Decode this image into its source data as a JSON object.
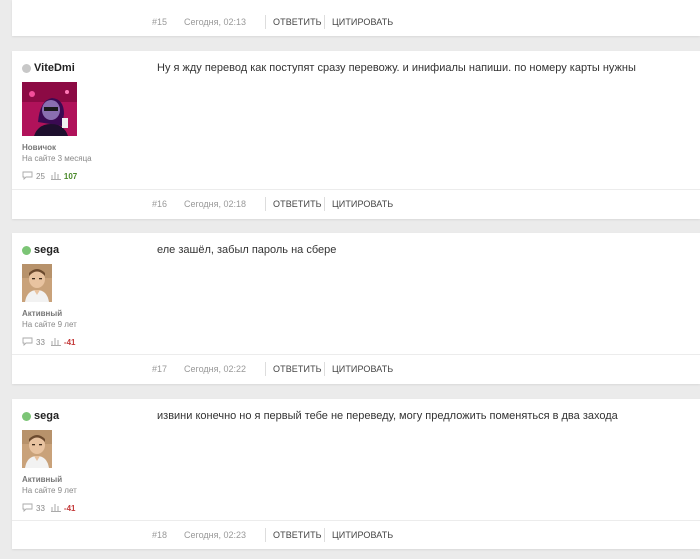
{
  "colors": {
    "online": "#7cc576",
    "offline": "#c8c8c8",
    "rep_positive": "#4a8a2a",
    "rep_negative": "#c43a3a"
  },
  "posts": [
    {
      "number": "#15",
      "time": "Сегодня, 02:13",
      "reply_label": "Ответить",
      "quote_label": "Цитировать"
    },
    {
      "username": "ViteDmi",
      "status": "offline",
      "avatar_icon": "avatar-vitedmi",
      "rank": "Новичок",
      "since": "На сайте 3 месяца",
      "comments": "25",
      "reputation": "107",
      "message": "Ну я жду перевод как поступят сразу перевожу. и инифиалы напиши. по номеру карты нужны",
      "number": "#16",
      "time": "Сегодня, 02:18",
      "reply_label": "Ответить",
      "quote_label": "Цитировать"
    },
    {
      "username": "sega",
      "status": "online",
      "avatar_icon": "avatar-sega",
      "rank": "Активный",
      "since": "На сайте 9 лет",
      "comments": "33",
      "reputation": "-41",
      "message": "еле зашёл, забыл пароль на сбере",
      "number": "#17",
      "time": "Сегодня, 02:22",
      "reply_label": "Ответить",
      "quote_label": "Цитировать"
    },
    {
      "username": "sega",
      "status": "online",
      "avatar_icon": "avatar-sega",
      "rank": "Активный",
      "since": "На сайте 9 лет",
      "comments": "33",
      "reputation": "-41",
      "message": "извини конечно но я первый тебе не переведу, могу предложить поменяться в два захода",
      "number": "#18",
      "time": "Сегодня, 02:23",
      "reply_label": "Ответить",
      "quote_label": "Цитировать"
    }
  ]
}
